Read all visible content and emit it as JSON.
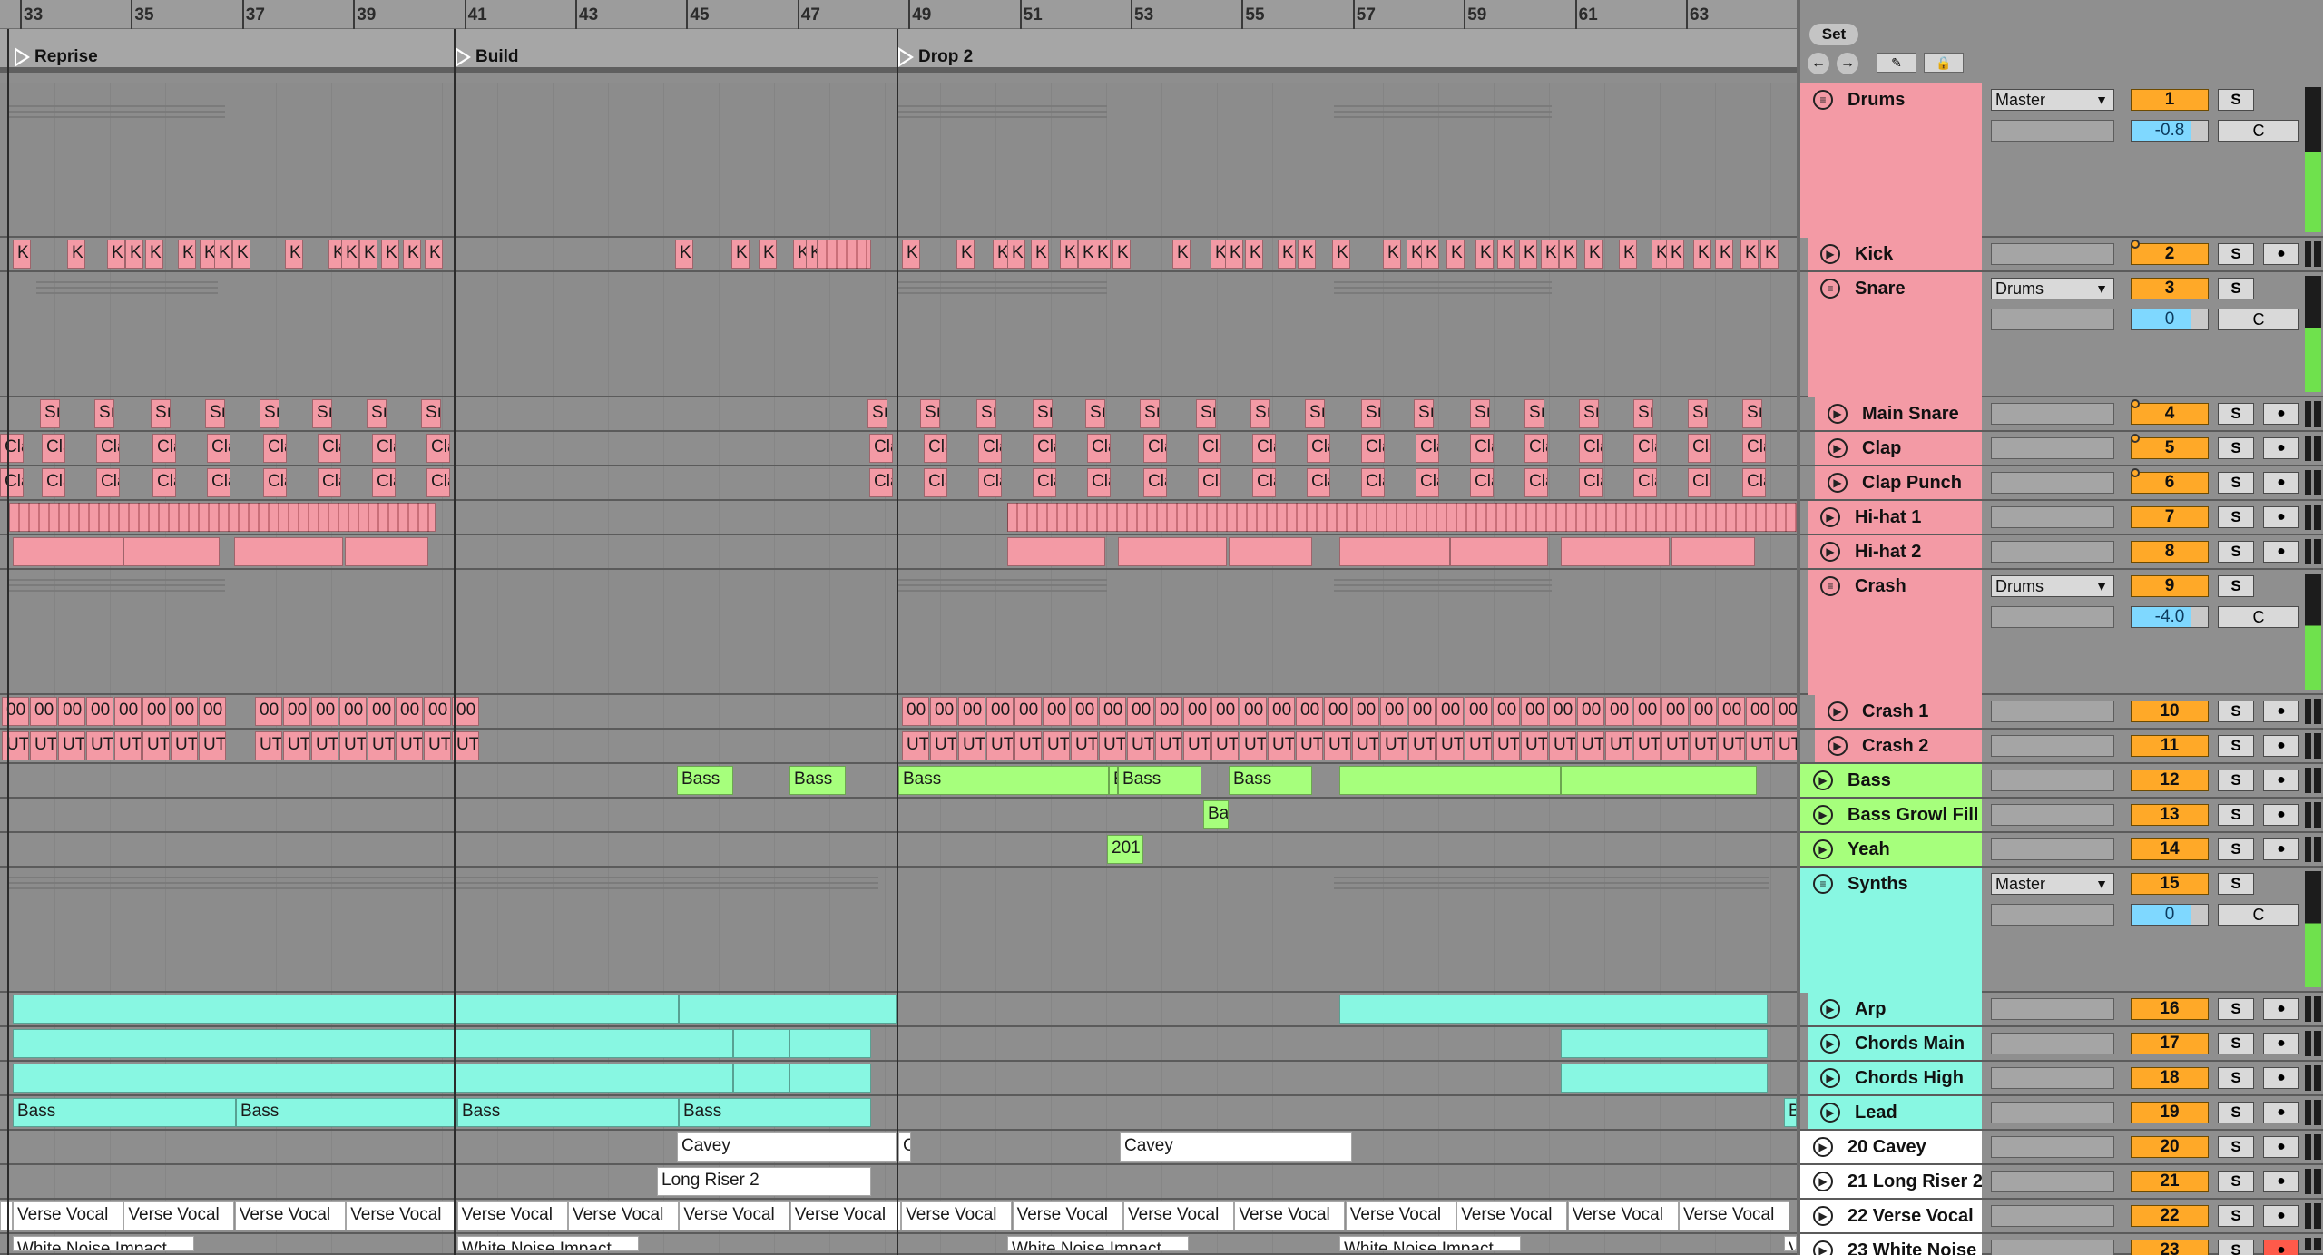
{
  "ruler": {
    "bars": [
      "33",
      "35",
      "37",
      "39",
      "41",
      "43",
      "45",
      "47",
      "49",
      "51",
      "53",
      "55",
      "57",
      "59",
      "61",
      "63"
    ]
  },
  "locators": [
    {
      "name": "Reprise"
    },
    {
      "name": "Build"
    },
    {
      "name": "Drop 2"
    }
  ],
  "set_panel": {
    "set_label": "Set",
    "back_icon": "←",
    "forward_icon": "→",
    "draw_icon": "✎",
    "lock_icon": "🔒"
  },
  "colors": {
    "drums": "#f39aa5",
    "bass": "#a6ff7c",
    "synths": "#88f7e2",
    "audio": "#ffffff",
    "track_number": "#ffa928",
    "volume": "#7fd8ff",
    "arm_active": "#ff5a4a"
  },
  "tracks": [
    {
      "name": "Drums",
      "number": "1",
      "output": "Master",
      "volume": "-0.8",
      "pan": "C",
      "solo": "S",
      "type": "group"
    },
    {
      "name": "Kick",
      "number": "2",
      "solo": "S"
    },
    {
      "name": "Snare",
      "number": "3",
      "output": "Drums",
      "volume": "0",
      "pan": "C",
      "solo": "S",
      "type": "group"
    },
    {
      "name": "Main Snare",
      "number": "4",
      "solo": "S"
    },
    {
      "name": "Clap",
      "number": "5",
      "solo": "S"
    },
    {
      "name": "Clap Punch",
      "number": "6",
      "solo": "S"
    },
    {
      "name": "Hi-hat 1",
      "number": "7",
      "solo": "S"
    },
    {
      "name": "Hi-hat 2",
      "number": "8",
      "solo": "S"
    },
    {
      "name": "Crash",
      "number": "9",
      "output": "Drums",
      "volume": "-4.0",
      "pan": "C",
      "solo": "S",
      "type": "group"
    },
    {
      "name": "Crash 1",
      "number": "10",
      "solo": "S"
    },
    {
      "name": "Crash 2",
      "number": "11",
      "solo": "S"
    },
    {
      "name": "Bass",
      "number": "12",
      "solo": "S"
    },
    {
      "name": "Bass Growl Fill",
      "number": "13",
      "solo": "S"
    },
    {
      "name": "Yeah",
      "number": "14",
      "solo": "S"
    },
    {
      "name": "Synths",
      "number": "15",
      "output": "Master",
      "volume": "0",
      "pan": "C",
      "solo": "S",
      "type": "group"
    },
    {
      "name": "Arp",
      "number": "16",
      "solo": "S"
    },
    {
      "name": "Chords Main",
      "number": "17",
      "solo": "S"
    },
    {
      "name": "Chords High",
      "number": "18",
      "solo": "S"
    },
    {
      "name": "Lead",
      "number": "19",
      "solo": "S"
    },
    {
      "name": "20 Cavey",
      "number": "20",
      "solo": "S"
    },
    {
      "name": "21 Long Riser 2",
      "number": "21",
      "solo": "S"
    },
    {
      "name": "22 Verse Vocal",
      "number": "22",
      "solo": "S"
    },
    {
      "name": "23 White Noise",
      "number": "23",
      "solo": "S"
    }
  ],
  "clip_labels": {
    "kick": "K",
    "snare": "Sı",
    "clap": "Cla",
    "crash1": "00",
    "crash2": "UT",
    "bass": "Bass",
    "bass_short": "Ba",
    "bass_tail": "E",
    "yeah": "201",
    "lead": "Bass",
    "lead_tail": "B",
    "cavey": "Cavey",
    "cavey_tail": "C",
    "riser": "Long Riser 2",
    "vocal": "Verse Vocal",
    "vocal_tail": "Verse Vocal (",
    "noise": "White Noise Impact",
    "noise_tail": "V"
  }
}
